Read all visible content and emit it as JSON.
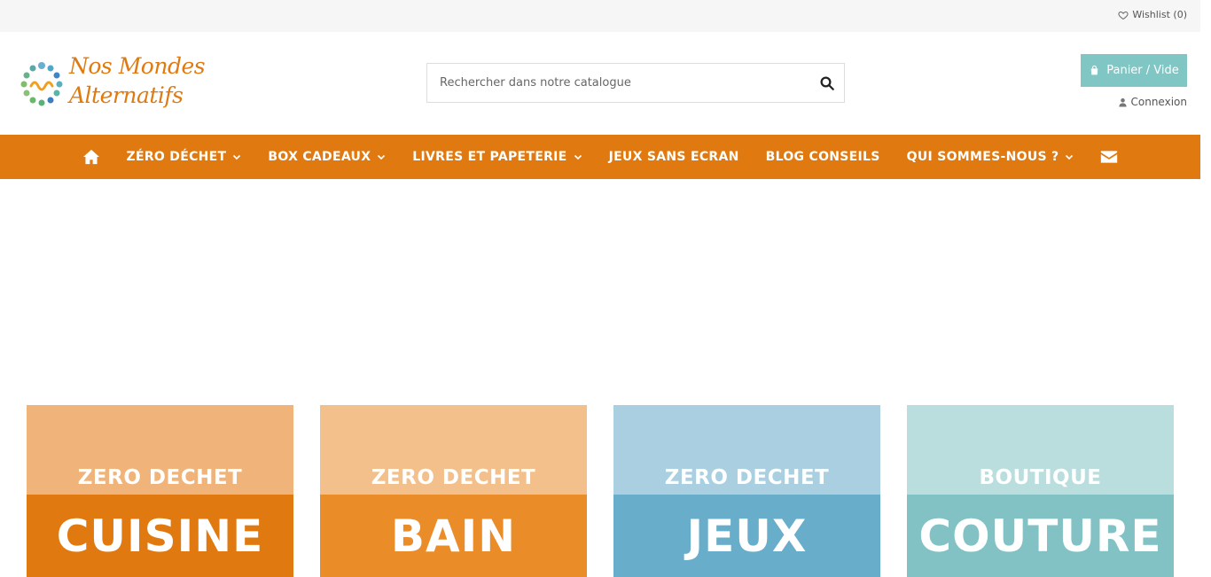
{
  "topbar": {
    "wishlist_label": "Wishlist (0)",
    "wishlist_icon": "heart-icon"
  },
  "logo": {
    "line1": "Nos Mondes",
    "line2": "Alternatifs",
    "brand_color": "#e07a10"
  },
  "search": {
    "placeholder": "Rechercher dans notre catalogue",
    "icon": "search-icon"
  },
  "cart": {
    "label": "Panier / Vide",
    "icon": "shopping-bag-icon",
    "color": "#7fc6c4"
  },
  "account": {
    "login_label": "Connexion",
    "icon": "user-icon"
  },
  "nav": {
    "color": "#e07a10",
    "home_icon": "home-icon",
    "items": [
      {
        "label": "ZÉRO DÉCHET",
        "dropdown": true
      },
      {
        "label": "BOX CADEAUX",
        "dropdown": true
      },
      {
        "label": "LIVRES ET PAPETERIE",
        "dropdown": true
      },
      {
        "label": "JEUX SANS ECRAN",
        "dropdown": false
      },
      {
        "label": "BLOG CONSEILS",
        "dropdown": false
      },
      {
        "label": "QUI SOMMES-NOUS ?",
        "dropdown": true
      }
    ],
    "contact_icon": "envelope-icon"
  },
  "tiles": [
    {
      "small": "ZERO DECHET",
      "big": "CUISINE",
      "top_color": "#f0b37a",
      "bottom_color": "#e07a10"
    },
    {
      "small": "ZERO DECHET",
      "big": "BAIN",
      "top_color": "#f3c08c",
      "bottom_color": "#ea8c28"
    },
    {
      "small": "ZERO DECHET",
      "big": "JEUX",
      "top_color": "#aacfe0",
      "bottom_color": "#68adc9"
    },
    {
      "small": "BOUTIQUE",
      "big": "COUTURE",
      "top_color": "#b9dedd",
      "bottom_color": "#82c2c4"
    }
  ]
}
